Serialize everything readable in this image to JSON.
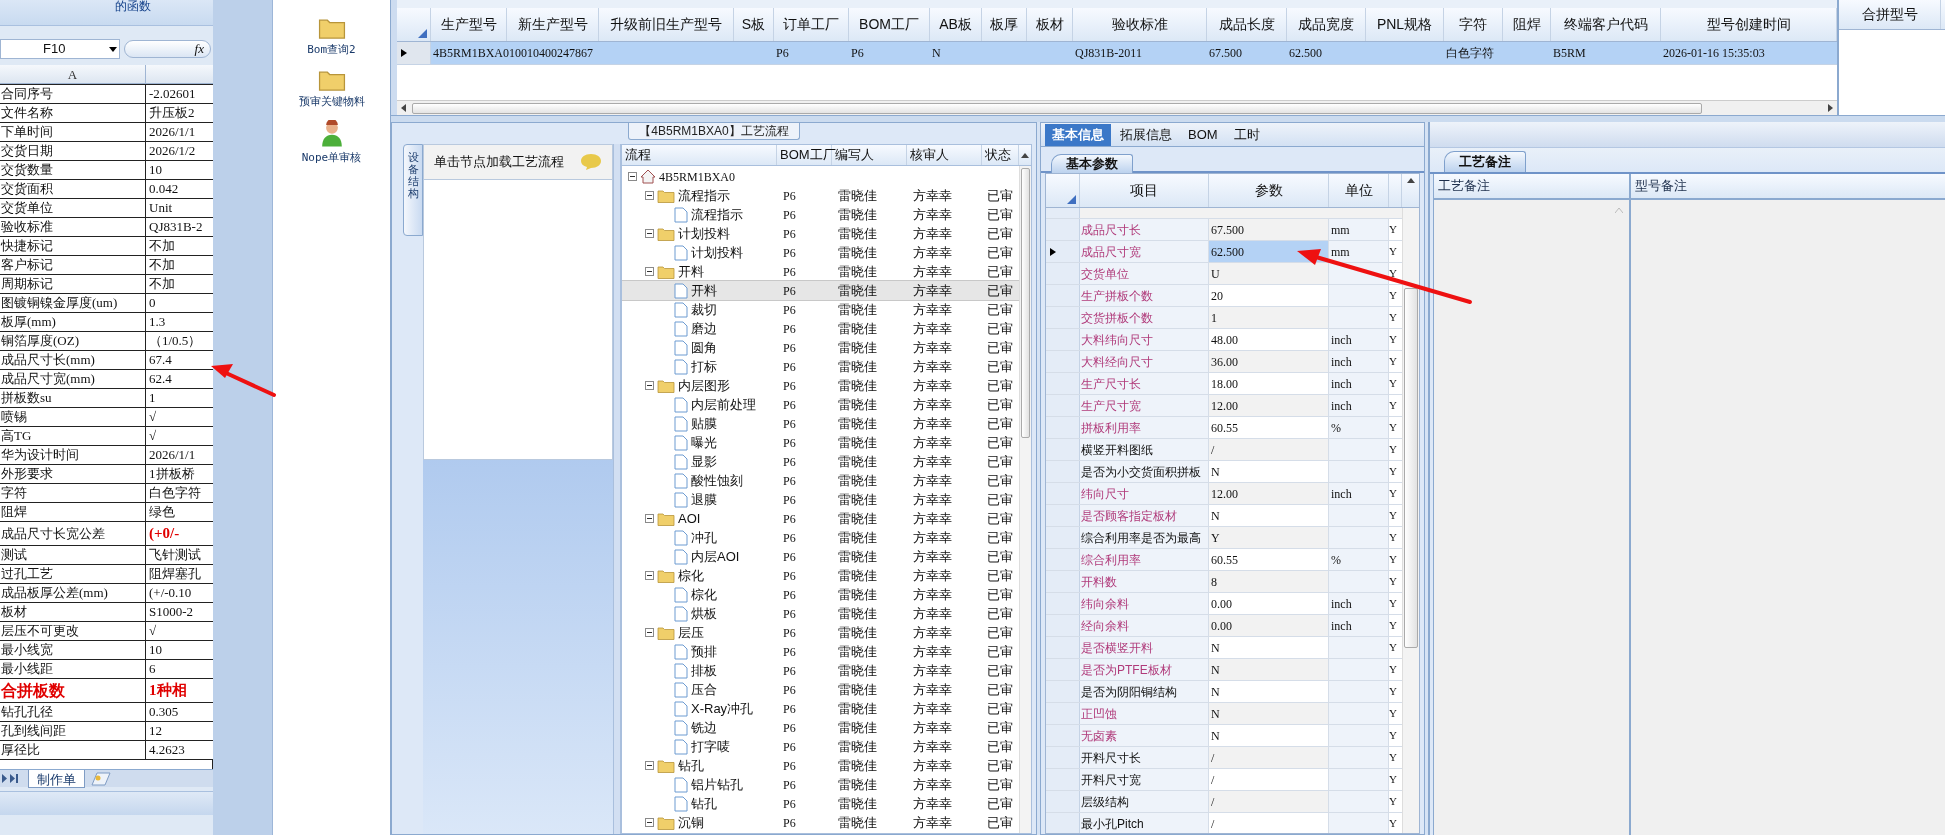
{
  "ribbon": {
    "label": "的函数"
  },
  "spreadsheet": {
    "name_box": "F10",
    "formula_button": "fx",
    "column_header": "A",
    "rows": [
      {
        "label": "合同序号",
        "value": "-2.02601",
        "kind": "plain"
      },
      {
        "label": "文件名称",
        "value": "升压板2",
        "kind": "plain"
      },
      {
        "label": "下单时间",
        "value": "2026/1/1",
        "kind": "plain"
      },
      {
        "label": "交货日期",
        "value": "2026/1/2",
        "kind": "plain"
      },
      {
        "label": "交货数量",
        "value": "10",
        "kind": "plain"
      },
      {
        "label": "交货面积",
        "value": "0.042",
        "kind": "plain"
      },
      {
        "label": "交货单位",
        "value": "Unit",
        "kind": "plain"
      },
      {
        "label": "验收标准",
        "value": "QJ831B-2",
        "kind": "plain"
      },
      {
        "label": "快捷标记",
        "value": "不加",
        "kind": "plain"
      },
      {
        "label": "客户标记",
        "value": "不加",
        "kind": "plain"
      },
      {
        "label": "周期标记",
        "value": "不加",
        "kind": "plain"
      },
      {
        "label": "图镀铜镍金厚度(um)",
        "value": "0",
        "kind": "plain"
      },
      {
        "label": "板厚(mm)",
        "value": "1.3",
        "kind": "plain"
      },
      {
        "label": "铜箔厚度(OZ)",
        "value": "（1/0.5）",
        "kind": "plain"
      },
      {
        "label": "成品尺寸长(mm)",
        "value": "67.4",
        "kind": "plain"
      },
      {
        "label": "成品尺寸宽(mm)",
        "value": "62.4",
        "kind": "plain"
      },
      {
        "label": "拼板数su",
        "value": "1",
        "kind": "plain"
      },
      {
        "label": "喷锡",
        "value": "√",
        "kind": "plain"
      },
      {
        "label": "高TG",
        "value": "√",
        "kind": "plain"
      },
      {
        "label": "华为设计时间",
        "value": "2026/1/1",
        "kind": "plain"
      },
      {
        "label": "外形要求",
        "value": "1拼板桥",
        "kind": "plain"
      },
      {
        "label": "字符",
        "value": "白色字符",
        "kind": "plain"
      },
      {
        "label": "阻焊",
        "value": "绿色",
        "kind": "plain"
      },
      {
        "label": "成品尺寸长宽公差",
        "value": "(+0/-",
        "kind": "value-red"
      },
      {
        "label": "测试",
        "value": "飞针测试",
        "kind": "plain"
      },
      {
        "label": "过孔工艺",
        "value": "阻焊塞孔",
        "kind": "plain"
      },
      {
        "label": "成品板厚公差(mm)",
        "value": "(+/-0.10",
        "kind": "plain"
      },
      {
        "label": "板材",
        "value": "S1000-2",
        "kind": "plain"
      },
      {
        "label": "层压不可更改",
        "value": "√",
        "kind": "plain"
      },
      {
        "label": "最小线宽",
        "value": "10",
        "kind": "plain"
      },
      {
        "label": "最小线距",
        "value": "6",
        "kind": "plain"
      },
      {
        "label": "合拼板数",
        "value": "1种相",
        "kind": "all-red"
      },
      {
        "label": "钻孔孔径",
        "value": "0.305",
        "kind": "plain"
      },
      {
        "label": "孔到线间距",
        "value": "12",
        "kind": "plain"
      },
      {
        "label": "厚径比",
        "value": "4.2623",
        "kind": "plain"
      }
    ],
    "sheet_tabs": [
      {
        "label": "制作单",
        "selected": true
      }
    ]
  },
  "shortcuts": [
    {
      "label": "Bom查询2",
      "kind": "folder"
    },
    {
      "label": "预审关键物料",
      "kind": "folder"
    },
    {
      "label": "Nope单审核",
      "kind": "person"
    }
  ],
  "model_table": {
    "columns": [
      "生产型号",
      "新生产型号",
      "升级前旧生产型号",
      "S板",
      "订单工厂",
      "BOM工厂",
      "AB板",
      "板厚",
      "板材",
      "验收标准",
      "成品长度",
      "成品宽度",
      "PNL规格",
      "字符",
      "阻焊",
      "终端客户代码",
      "型号创建时间"
    ],
    "rows": [
      {
        "selected": true,
        "cells": [
          "4B5RM1BXA0",
          "10010400247867",
          null,
          null,
          "P6",
          "P6",
          "N",
          null,
          null,
          "QJ831B-2011",
          "67.500",
          "62.500",
          null,
          "白色字符",
          null,
          "B5RM",
          "2026-01-16 15:35:03"
        ]
      }
    ]
  },
  "merge_panel": {
    "columns": [
      "合拼型号"
    ]
  },
  "process_panel": {
    "title": "【4B5RM1BXA0】工艺流程",
    "side_tab": "设备结构",
    "hint": "单击节点加载工艺流程",
    "columns": [
      "流程",
      "BOM工厂",
      "编写人",
      "核审人",
      "状态"
    ],
    "tree": [
      {
        "label": "4B5RM1BXA0",
        "kind": "root",
        "expanded": true,
        "selected": false,
        "children": [
          {
            "label": "流程指示",
            "kind": "folder",
            "expanded": true,
            "selected": false,
            "bom": "P6",
            "author": "雷晓佳",
            "reviewer": "方幸幸",
            "status": "已审",
            "children": [
              {
                "label": "流程指示",
                "kind": "doc",
                "selected": false,
                "bom": "P6",
                "author": "雷晓佳",
                "reviewer": "方幸幸",
                "status": "已审"
              }
            ]
          },
          {
            "label": "计划投料",
            "kind": "folder",
            "expanded": true,
            "selected": false,
            "bom": "P6",
            "author": "雷晓佳",
            "reviewer": "方幸幸",
            "status": "已审",
            "children": [
              {
                "label": "计划投料",
                "kind": "doc",
                "selected": false,
                "bom": "P6",
                "author": "雷晓佳",
                "reviewer": "方幸幸",
                "status": "已审"
              }
            ]
          },
          {
            "label": "开料",
            "kind": "folder",
            "expanded": true,
            "selected": false,
            "bom": "P6",
            "author": "雷晓佳",
            "reviewer": "方幸幸",
            "status": "已审",
            "children": [
              {
                "label": "开料",
                "kind": "doc",
                "selected": true,
                "bom": "P6",
                "author": "雷晓佳",
                "reviewer": "方幸幸",
                "status": "已审"
              },
              {
                "label": "裁切",
                "kind": "doc",
                "selected": false,
                "bom": "P6",
                "author": "雷晓佳",
                "reviewer": "方幸幸",
                "status": "已审"
              },
              {
                "label": "磨边",
                "kind": "doc",
                "selected": false,
                "bom": "P6",
                "author": "雷晓佳",
                "reviewer": "方幸幸",
                "status": "已审"
              },
              {
                "label": "圆角",
                "kind": "doc",
                "selected": false,
                "bom": "P6",
                "author": "雷晓佳",
                "reviewer": "方幸幸",
                "status": "已审"
              },
              {
                "label": "打标",
                "kind": "doc",
                "selected": false,
                "bom": "P6",
                "author": "雷晓佳",
                "reviewer": "方幸幸",
                "status": "已审"
              }
            ]
          },
          {
            "label": "内层图形",
            "kind": "folder",
            "expanded": true,
            "selected": false,
            "bom": "P6",
            "author": "雷晓佳",
            "reviewer": "方幸幸",
            "status": "已审",
            "children": [
              {
                "label": "内层前处理",
                "kind": "doc",
                "selected": false,
                "bom": "P6",
                "author": "雷晓佳",
                "reviewer": "方幸幸",
                "status": "已审"
              },
              {
                "label": "贴膜",
                "kind": "doc",
                "selected": false,
                "bom": "P6",
                "author": "雷晓佳",
                "reviewer": "方幸幸",
                "status": "已审"
              },
              {
                "label": "曝光",
                "kind": "doc",
                "selected": false,
                "bom": "P6",
                "author": "雷晓佳",
                "reviewer": "方幸幸",
                "status": "已审"
              },
              {
                "label": "显影",
                "kind": "doc",
                "selected": false,
                "bom": "P6",
                "author": "雷晓佳",
                "reviewer": "方幸幸",
                "status": "已审"
              },
              {
                "label": "酸性蚀刻",
                "kind": "doc",
                "selected": false,
                "bom": "P6",
                "author": "雷晓佳",
                "reviewer": "方幸幸",
                "status": "已审"
              },
              {
                "label": "退膜",
                "kind": "doc",
                "selected": false,
                "bom": "P6",
                "author": "雷晓佳",
                "reviewer": "方幸幸",
                "status": "已审"
              }
            ]
          },
          {
            "label": "AOI",
            "kind": "folder",
            "expanded": true,
            "selected": false,
            "bom": "P6",
            "author": "雷晓佳",
            "reviewer": "方幸幸",
            "status": "已审",
            "children": [
              {
                "label": "冲孔",
                "kind": "doc",
                "selected": false,
                "bom": "P6",
                "author": "雷晓佳",
                "reviewer": "方幸幸",
                "status": "已审"
              },
              {
                "label": "内层AOI",
                "kind": "doc",
                "selected": false,
                "bom": "P6",
                "author": "雷晓佳",
                "reviewer": "方幸幸",
                "status": "已审"
              }
            ]
          },
          {
            "label": "棕化",
            "kind": "folder",
            "expanded": true,
            "selected": false,
            "bom": "P6",
            "author": "雷晓佳",
            "reviewer": "方幸幸",
            "status": "已审",
            "children": [
              {
                "label": "棕化",
                "kind": "doc",
                "selected": false,
                "bom": "P6",
                "author": "雷晓佳",
                "reviewer": "方幸幸",
                "status": "已审"
              },
              {
                "label": "烘板",
                "kind": "doc",
                "selected": false,
                "bom": "P6",
                "author": "雷晓佳",
                "reviewer": "方幸幸",
                "status": "已审"
              }
            ]
          },
          {
            "label": "层压",
            "kind": "folder",
            "expanded": true,
            "selected": false,
            "bom": "P6",
            "author": "雷晓佳",
            "reviewer": "方幸幸",
            "status": "已审",
            "children": [
              {
                "label": "预排",
                "kind": "doc",
                "selected": false,
                "bom": "P6",
                "author": "雷晓佳",
                "reviewer": "方幸幸",
                "status": "已审"
              },
              {
                "label": "排板",
                "kind": "doc",
                "selected": false,
                "bom": "P6",
                "author": "雷晓佳",
                "reviewer": "方幸幸",
                "status": "已审"
              },
              {
                "label": "压合",
                "kind": "doc",
                "selected": false,
                "bom": "P6",
                "author": "雷晓佳",
                "reviewer": "方幸幸",
                "status": "已审"
              },
              {
                "label": "X-Ray冲孔",
                "kind": "doc",
                "selected": false,
                "bom": "P6",
                "author": "雷晓佳",
                "reviewer": "方幸幸",
                "status": "已审"
              },
              {
                "label": "铣边",
                "kind": "doc",
                "selected": false,
                "bom": "P6",
                "author": "雷晓佳",
                "reviewer": "方幸幸",
                "status": "已审"
              },
              {
                "label": "打字唛",
                "kind": "doc",
                "selected": false,
                "bom": "P6",
                "author": "雷晓佳",
                "reviewer": "方幸幸",
                "status": "已审"
              }
            ]
          },
          {
            "label": "钻孔",
            "kind": "folder",
            "expanded": true,
            "selected": false,
            "bom": "P6",
            "author": "雷晓佳",
            "reviewer": "方幸幸",
            "status": "已审",
            "children": [
              {
                "label": "铝片钻孔",
                "kind": "doc",
                "selected": false,
                "bom": "P6",
                "author": "雷晓佳",
                "reviewer": "方幸幸",
                "status": "已审"
              },
              {
                "label": "钻孔",
                "kind": "doc",
                "selected": false,
                "bom": "P6",
                "author": "雷晓佳",
                "reviewer": "方幸幸",
                "status": "已审"
              }
            ]
          },
          {
            "label": "沉铜",
            "kind": "folder",
            "expanded": true,
            "selected": false,
            "bom": "P6",
            "author": "雷晓佳",
            "reviewer": "方幸幸",
            "status": "已审"
          }
        ]
      }
    ]
  },
  "params_panel": {
    "tabs": [
      {
        "label": "基本信息",
        "selected": true
      },
      {
        "label": "拓展信息",
        "selected": false
      },
      {
        "label": "BOM",
        "selected": false
      },
      {
        "label": "工时",
        "selected": false
      }
    ],
    "subtab": "基本参数",
    "columns": [
      "项目",
      "参数",
      "单位"
    ],
    "rows": [
      {
        "item": "成品尺寸长",
        "value": "67.500",
        "unit": "mm",
        "flag": "Y",
        "required": true,
        "selected": false
      },
      {
        "item": "成品尺寸宽",
        "value": "62.500",
        "unit": "mm",
        "flag": "Y",
        "required": true,
        "selected": true
      },
      {
        "item": "交货单位",
        "value": "U",
        "flag": "Y",
        "required": true,
        "selected": false
      },
      {
        "item": "生产拼板个数",
        "value": "20",
        "flag": "Y",
        "required": true,
        "selected": false
      },
      {
        "item": "交货拼板个数",
        "value": "1",
        "flag": "Y",
        "required": true,
        "selected": false
      },
      {
        "item": "大料纬向尺寸",
        "value": "48.00",
        "unit": "inch",
        "flag": "Y",
        "required": true,
        "selected": false
      },
      {
        "item": "大料经向尺寸",
        "value": "36.00",
        "unit": "inch",
        "flag": "Y",
        "required": true,
        "selected": false
      },
      {
        "item": "生产尺寸长",
        "value": "18.00",
        "unit": "inch",
        "flag": "Y",
        "required": true,
        "selected": false
      },
      {
        "item": "生产尺寸宽",
        "value": "12.00",
        "unit": "inch",
        "flag": "Y",
        "required": true,
        "selected": false
      },
      {
        "item": "拼板利用率",
        "value": "60.55",
        "unit": "%",
        "flag": "Y",
        "required": true,
        "selected": false
      },
      {
        "item": "横竖开料图纸",
        "value": "/",
        "flag": "Y",
        "required": false,
        "selected": false
      },
      {
        "item": "是否为小交货面积拼板",
        "value": "N",
        "flag": "Y",
        "required": false,
        "selected": false
      },
      {
        "item": "纬向尺寸",
        "value": "12.00",
        "unit": "inch",
        "flag": "Y",
        "required": true,
        "selected": false
      },
      {
        "item": "是否顾客指定板材",
        "value": "N",
        "flag": "Y",
        "required": true,
        "selected": false
      },
      {
        "item": "综合利用率是否为最高",
        "value": "Y",
        "flag": "Y",
        "required": false,
        "selected": false
      },
      {
        "item": "综合利用率",
        "value": "60.55",
        "unit": "%",
        "flag": "Y",
        "required": true,
        "selected": false
      },
      {
        "item": "开料数",
        "value": "8",
        "flag": "Y",
        "required": true,
        "selected": false
      },
      {
        "item": "纬向余料",
        "value": "0.00",
        "unit": "inch",
        "flag": "Y",
        "required": true,
        "selected": false
      },
      {
        "item": "经向余料",
        "value": "0.00",
        "unit": "inch",
        "flag": "Y",
        "required": true,
        "selected": false
      },
      {
        "item": "是否横竖开料",
        "value": "N",
        "flag": "Y",
        "required": true,
        "selected": false
      },
      {
        "item": "是否为PTFE板材",
        "value": "N",
        "flag": "Y",
        "required": true,
        "selected": false
      },
      {
        "item": "是否为阴阳铜结构",
        "value": "N",
        "flag": "Y",
        "required": false,
        "selected": false
      },
      {
        "item": "正凹蚀",
        "value": "N",
        "flag": "Y",
        "required": true,
        "selected": false
      },
      {
        "item": "无卤素",
        "value": "N",
        "flag": "Y",
        "required": true,
        "selected": false
      },
      {
        "item": "开料尺寸长",
        "value": "/",
        "flag": "Y",
        "required": false,
        "selected": false
      },
      {
        "item": "开料尺寸宽",
        "value": "/",
        "flag": "Y",
        "required": false,
        "selected": false
      },
      {
        "item": "层级结构",
        "value": "/",
        "flag": "Y",
        "required": false,
        "selected": false
      },
      {
        "item": "最小孔Pitch",
        "value": "/",
        "flag": "Y",
        "required": false,
        "selected": false
      }
    ]
  },
  "notes_panel": {
    "tab": "工艺备注",
    "columns": [
      "工艺备注",
      "型号备注"
    ]
  }
}
